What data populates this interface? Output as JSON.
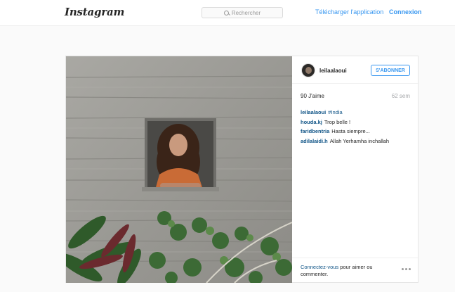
{
  "header": {
    "logo": "Instagram",
    "search_placeholder": "Rechercher",
    "download_label": "Télécharger l'application",
    "login_label": "Connexion"
  },
  "post": {
    "username": "leilaalaoui",
    "follow_label": "S'ABONNER",
    "likes": "90 J'aime",
    "age": "62 sem",
    "comments": [
      {
        "author": "leilaalaoui",
        "text": "#India",
        "is_hashtag": true
      },
      {
        "author": "houda.kj",
        "text": "Trop belle !",
        "is_hashtag": false
      },
      {
        "author": "faridbentria",
        "text": "Hasta siempre...",
        "is_hashtag": false
      },
      {
        "author": "adilalaidi.h",
        "text": "Allah Yerhamha inchallah",
        "is_hashtag": false
      }
    ],
    "footer_link": "Connectez-vous",
    "footer_text": " pour aimer ou commenter."
  },
  "colors": {
    "link_blue": "#3897f0",
    "author_blue": "#125688",
    "background": "#fafafa"
  },
  "icons": [
    "search-icon",
    "more-options-icon"
  ]
}
